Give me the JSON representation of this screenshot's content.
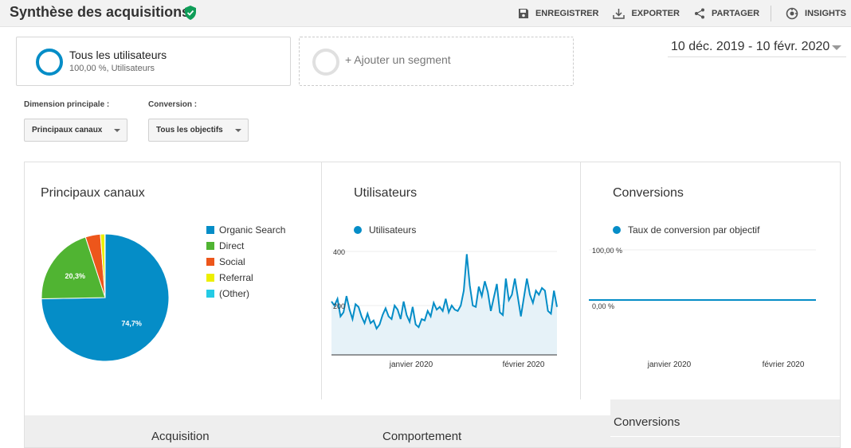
{
  "header": {
    "title": "Synthèse des acquisitions",
    "actions": [
      {
        "label": "ENREGISTRER",
        "icon": "save-icon"
      },
      {
        "label": "EXPORTER",
        "icon": "download-icon"
      },
      {
        "label": "PARTAGER",
        "icon": "share-icon"
      },
      {
        "label": "INSIGHTS",
        "icon": "insights-icon"
      }
    ]
  },
  "segments": {
    "active": {
      "label": "Tous les utilisateurs",
      "sub": "100,00 %, Utilisateurs"
    },
    "add": {
      "label": "+ Ajouter un segment"
    }
  },
  "date_range": "10 déc. 2019 - 10 févr. 2020",
  "filters": {
    "dimension": {
      "label": "Dimension principale :",
      "value": "Principaux canaux"
    },
    "conversion": {
      "label": "Conversion :",
      "value": "Tous les objectifs"
    }
  },
  "panels": {
    "channels": {
      "title": "Principaux canaux"
    },
    "users": {
      "title": "Utilisateurs",
      "series": "Utilisateurs"
    },
    "conversions": {
      "title": "Conversions",
      "series": "Taux de conversion par objectif"
    }
  },
  "table_header": {
    "acquisition": "Acquisition",
    "behaviour": "Comportement",
    "conversions": "Conversions"
  },
  "colors": {
    "blue": "#058dc7",
    "green": "#50b432",
    "orange": "#ed561b",
    "yellow": "#edef00",
    "cyan": "#24cbe5"
  },
  "chart_data": [
    {
      "type": "pie",
      "slices": [
        {
          "name": "Organic Search",
          "value": 74.7,
          "label": "74,7%",
          "color": "#058dc7"
        },
        {
          "name": "Direct",
          "value": 20.3,
          "label": "20,3%",
          "color": "#50b432"
        },
        {
          "name": "Social",
          "value": 3.8,
          "label": "",
          "color": "#ed561b"
        },
        {
          "name": "Referral",
          "value": 1.1,
          "label": "",
          "color": "#edef00"
        },
        {
          "name": "(Other)",
          "value": 0.1,
          "label": "",
          "color": "#24cbe5"
        }
      ]
    },
    {
      "type": "area",
      "series": [
        {
          "name": "Utilisateurs",
          "values": [
            215,
            200,
            225,
            160,
            175,
            235,
            185,
            150,
            205,
            195,
            160,
            135,
            170,
            135,
            145,
            115,
            130,
            165,
            190,
            160,
            150,
            200,
            185,
            150,
            215,
            165,
            140,
            195,
            130,
            120,
            150,
            145,
            180,
            160,
            210,
            185,
            195,
            180,
            225,
            175,
            200,
            185,
            180,
            200,
            255,
            390,
            275,
            200,
            195,
            270,
            235,
            290,
            250,
            180,
            230,
            280,
            175,
            165,
            300,
            220,
            240,
            300,
            230,
            160,
            230,
            300,
            240,
            210,
            255,
            240,
            265,
            255,
            180,
            170,
            255,
            195
          ]
        }
      ],
      "x_tick_labels": [
        "janvier 2020",
        "février 2020"
      ],
      "y_tick_labels": [
        "400",
        "200"
      ],
      "ylim": [
        0,
        420
      ]
    },
    {
      "type": "line",
      "series": [
        {
          "name": "Taux de conversion par objectif",
          "values": [
            0,
            0
          ]
        }
      ],
      "x_tick_labels": [
        "janvier 2020",
        "février 2020"
      ],
      "y_tick_labels": [
        "100,00 %",
        "0,00 %"
      ]
    }
  ]
}
